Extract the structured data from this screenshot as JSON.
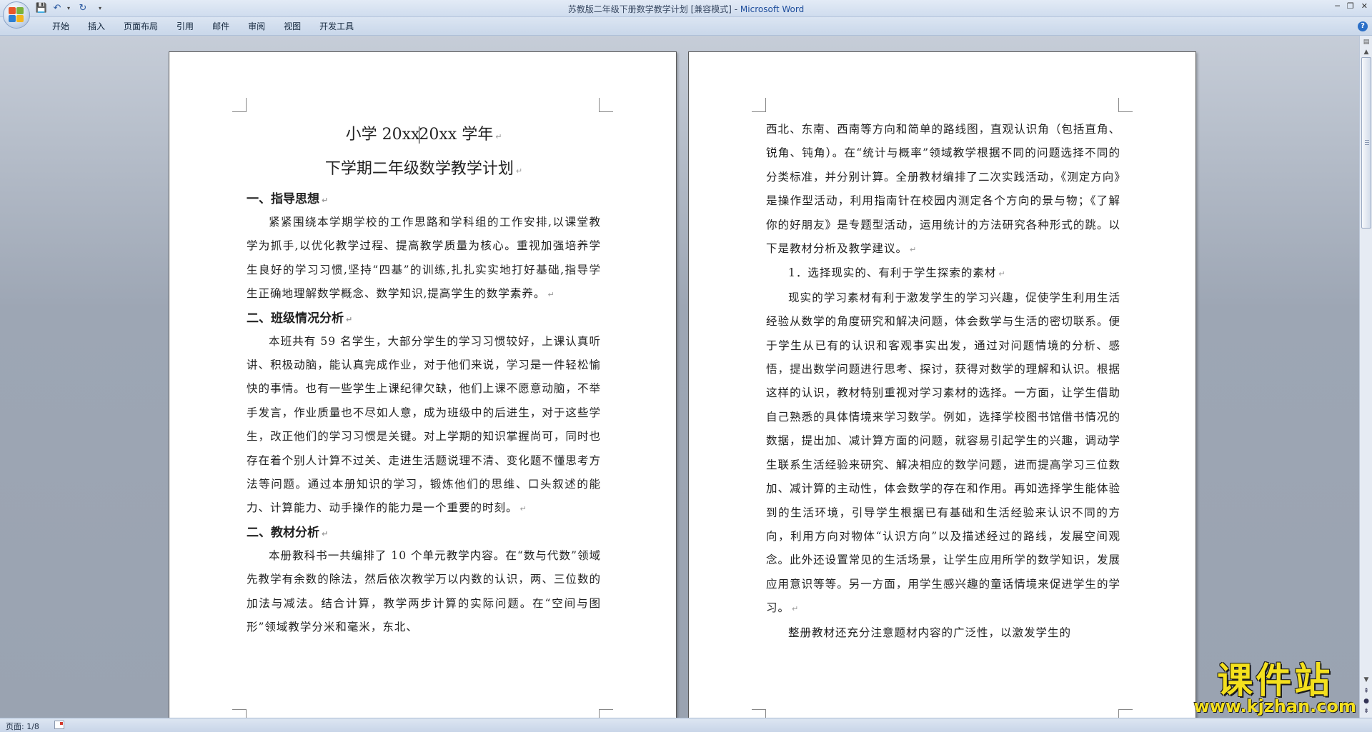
{
  "window": {
    "title_doc": "苏教版二年级下册数学教学计划 [兼容模式] - ",
    "title_app": "Microsoft Word",
    "controls": [
      "─",
      "❐",
      "✕"
    ]
  },
  "quick_access": {
    "icons": [
      "save-icon",
      "undo-icon",
      "redo-icon",
      "customize-icon"
    ]
  },
  "ribbon": {
    "tabs": [
      "开始",
      "插入",
      "页面布局",
      "引用",
      "邮件",
      "审阅",
      "视图",
      "开发工具"
    ],
    "help_label": "?"
  },
  "page1": {
    "title_a": "小学 20xx",
    "title_b": "20xx 学年",
    "title2": "下学期二年级数学教学计划",
    "h1": "一、指导思想",
    "p1": "紧紧围绕本学期学校的工作思路和学科组的工作安排,以课堂教学为抓手,以优化教学过程、提高教学质量为核心。重视加强培养学生良好的学习习惯,坚持“四基”的训练,扎扎实实地打好基础,指导学生正确地理解数学概念、数学知识,提高学生的数学素养。",
    "h2": "二、班级情况分析",
    "p2": "本班共有 59 名学生，大部分学生的学习习惯较好，上课认真听讲、积极动脑，能认真完成作业，对于他们来说，学习是一件轻松愉快的事情。也有一些学生上课纪律欠缺，他们上课不愿意动脑，不举手发言，作业质量也不尽如人意，成为班级中的后进生，对于这些学生，改正他们的学习习惯是关键。对上学期的知识掌握尚可，同时也存在着个别人计算不过关、走进生活题说理不清、变化题不懂思考方法等问题。通过本册知识的学习，锻炼他们的思维、口头叙述的能力、计算能力、动手操作的能力是一个重要的时刻。",
    "h3": "二、教材分析",
    "p3": "本册教科书一共编排了 10 个单元教学内容。在“数与代数”领域先教学有余数的除法，然后依次教学万以内数的认识，两、三位数的加法与减法。结合计算，教学两步计算的实际问题。在“空间与图形”领域教学分米和毫米，东北、"
  },
  "page2": {
    "p1": "西北、东南、西南等方向和简单的路线图，直观认识角（包括直角、锐角、钝角）。在“统计与概率”领域教学根据不同的问题选择不同的分类标准，并分别计算。全册教材编排了二次实践活动，《测定方向》是操作型活动，利用指南针在校园内测定各个方向的景与物；《了解你的好朋友》是专题型活动，运用统计的方法研究各种形式的跳。以下是教材分析及教学建议。",
    "item1": "1．选择现实的、有利于学生探索的素材",
    "p2": "现实的学习素材有利于激发学生的学习兴趣，促使学生利用生活经验从数学的角度研究和解决问题，体会数学与生活的密切联系。便于学生从已有的认识和客观事实出发，通过对问题情境的分析、感悟，提出数学问题进行思考、探讨，获得对数学的理解和认识。根据这样的认识，教材特别重视对学习素材的选择。一方面，让学生借助自己熟悉的具体情境来学习数学。例如，选择学校图书馆借书情况的数据，提出加、减计算方面的问题，就容易引起学生的兴趣，调动学生联系生活经验来研究、解决相应的数学问题，进而提高学习三位数加、减计算的主动性，体会数学的存在和作用。再如选择学生能体验到的生活环境，引导学生根据已有基础和生活经验来认识不同的方向，利用方向对物体“认识方向”以及描述经过的路线，发展空间观念。此外还设置常见的生活场景，让学生应用所学的数学知识，发展应用意识等等。另一方面，用学生感兴趣的童话情境来促进学生的学习。",
    "p3": "整册教材还充分注意题材内容的广泛性，以激发学生的"
  },
  "paragraph_mark": "↵",
  "statusbar": {
    "page_label": "页面: 1/8"
  },
  "watermark": {
    "text": "课件站",
    "url": "www.kjzhan.com"
  }
}
